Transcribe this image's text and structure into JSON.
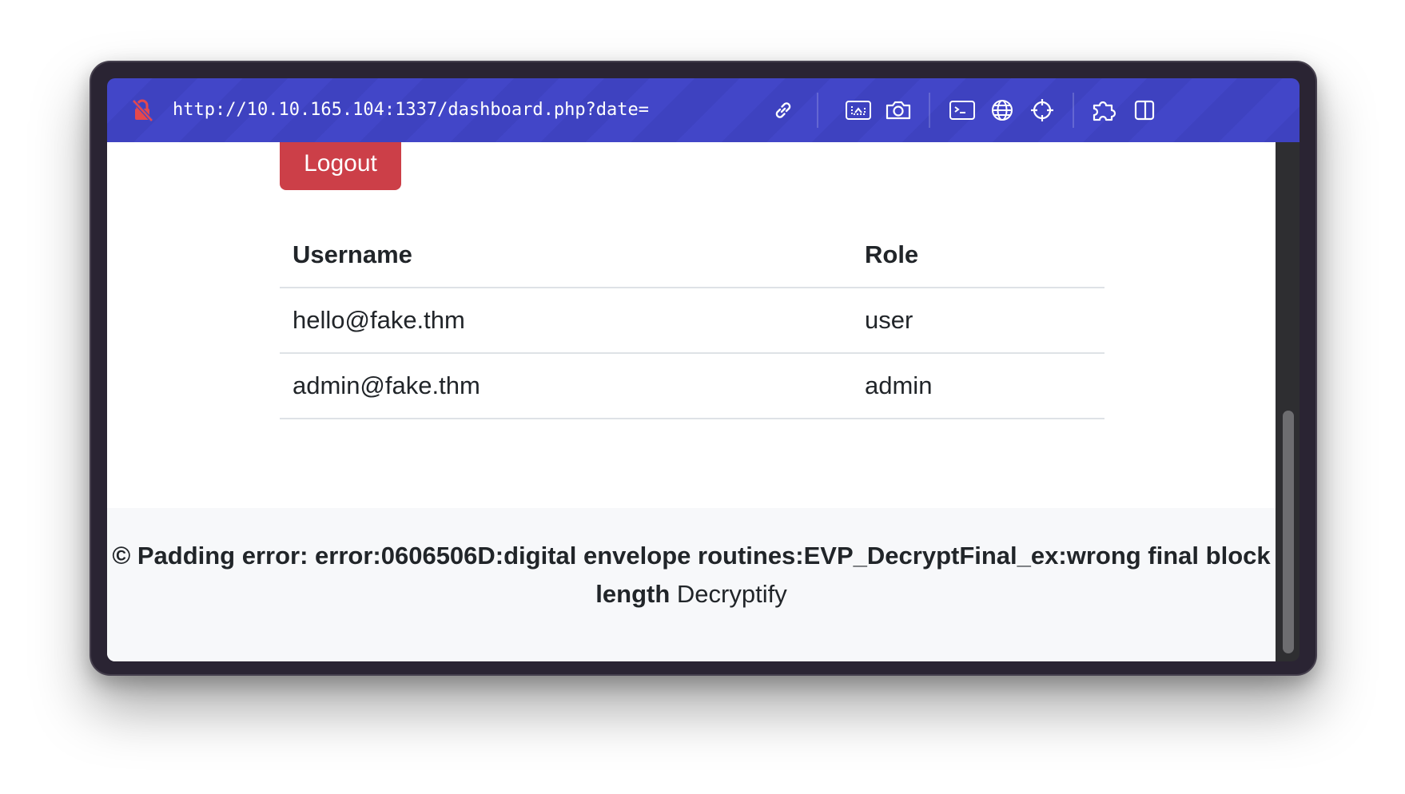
{
  "browser": {
    "url": "http://10.10.165.104:1337/dashboard.php?date=",
    "icons": [
      "not-secure-lock-icon",
      "link-icon",
      "screenshot-area-icon",
      "camera-icon",
      "terminal-icon",
      "globe-icon",
      "crosshair-icon",
      "extensions-puzzle-icon",
      "split-view-icon"
    ]
  },
  "page": {
    "logout_label": "Logout",
    "table": {
      "headers": [
        "Username",
        "Role"
      ],
      "rows": [
        [
          "hello@fake.thm",
          "user"
        ],
        [
          "admin@fake.thm",
          "admin"
        ]
      ]
    },
    "footer": {
      "copyright_symbol": "©",
      "error_text": "Padding error: error:0606506D:digital envelope routines:EVP_DecryptFinal_ex:wrong final block length",
      "brand": "Decryptify"
    }
  },
  "colors": {
    "toolbar": "#4246c8",
    "logout_button": "#cc3f48",
    "lock_icon": "#e5484d"
  }
}
